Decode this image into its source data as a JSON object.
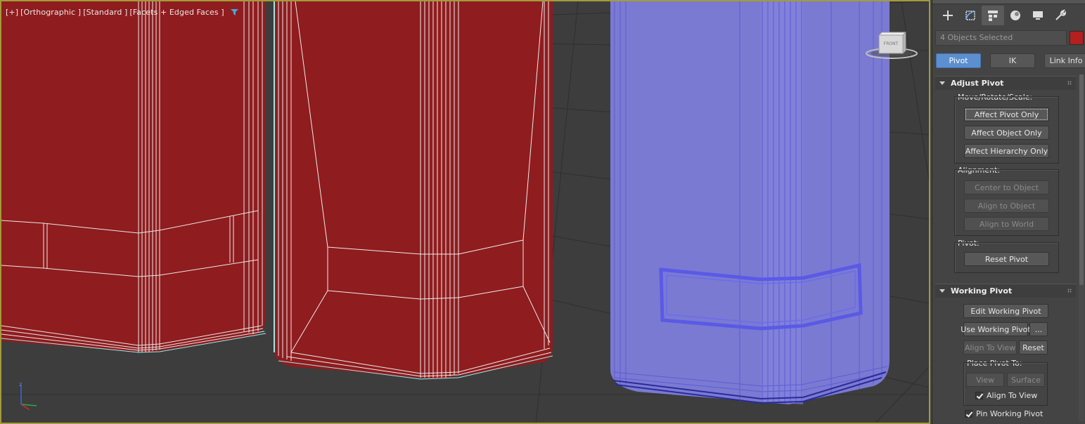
{
  "viewport": {
    "label_parts": [
      "[+]",
      "[Orthographic ]",
      "[Standard ]",
      "[Facets + Edged Faces ]"
    ],
    "viewcube_text": "FRONT",
    "axis_label": "z",
    "accent_border": "#a39a3a"
  },
  "panel": {
    "tabs": [
      {
        "name": "create-tab",
        "icon": "plus-icon"
      },
      {
        "name": "modify-tab",
        "icon": "modify-icon"
      },
      {
        "name": "hierarchy-tab",
        "icon": "hierarchy-icon"
      },
      {
        "name": "motion-tab",
        "icon": "motion-icon"
      },
      {
        "name": "display-tab",
        "icon": "display-icon"
      },
      {
        "name": "utilities-tab",
        "icon": "wrench-icon"
      }
    ],
    "selection_text": "4 Objects Selected",
    "selection_color": "#b3201f",
    "modes": [
      "Pivot",
      "IK",
      "Link Info"
    ],
    "active_mode": "Pivot",
    "adjust_pivot": {
      "title": "Adjust Pivot",
      "move_label": "Move/Rotate/Scale:",
      "affect_pivot": "Affect Pivot Only",
      "affect_object": "Affect Object Only",
      "affect_hierarchy": "Affect Hierarchy Only",
      "alignment_label": "Alignment:",
      "center_to_object": "Center to Object",
      "align_to_object": "Align to Object",
      "align_to_world": "Align to World",
      "pivot_label": "Pivot:",
      "reset_pivot": "Reset Pivot"
    },
    "working_pivot": {
      "title": "Working Pivot",
      "edit": "Edit Working Pivot",
      "use": "Use Working Pivot",
      "more": "...",
      "align_to_view": "Align To View",
      "reset": "Reset",
      "place_label": "Place Pivot To:",
      "view": "View",
      "surface": "Surface",
      "align_to_view_check": "Align To View",
      "pin": "Pin Working Pivot"
    }
  }
}
